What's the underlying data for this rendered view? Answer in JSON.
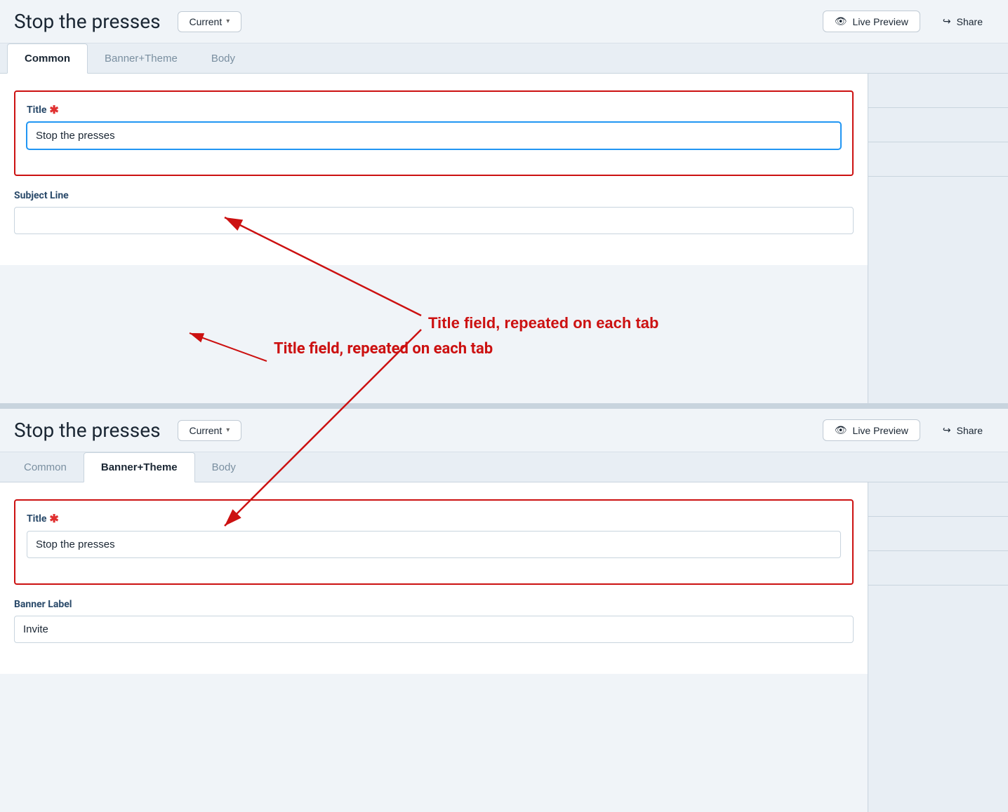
{
  "page": {
    "title": "Stop the presses"
  },
  "header": {
    "title": "Stop the presses",
    "version_label": "Current",
    "version_chevron": "▾",
    "live_preview_label": "Live Preview",
    "share_label": "Share"
  },
  "tabs": {
    "common_label": "Common",
    "banner_theme_label": "Banner+Theme",
    "body_label": "Body"
  },
  "form_top": {
    "title_label": "Title",
    "title_required": "✱",
    "title_value": "Stop the presses",
    "title_placeholder": "",
    "subject_line_label": "Subject Line",
    "subject_line_placeholder": ""
  },
  "annotation": {
    "text": "Title field, repeated on each tab"
  },
  "form_bottom": {
    "title_label": "Title",
    "title_required": "✱",
    "title_value": "Stop the presses",
    "banner_label_label": "Banner Label",
    "banner_label_value": "Invite"
  },
  "icons": {
    "eye": "👁",
    "share": "↪"
  }
}
